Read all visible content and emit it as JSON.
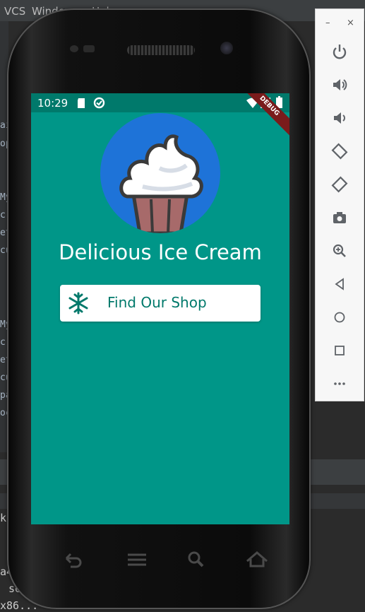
{
  "ide": {
    "menu": [
      "VCS",
      "Window",
      "Help"
    ],
    "code_lines": [
      "ai",
      "op",
      "My",
      "cr",
      "et",
      "cu",
      "My",
      "cr",
      "et",
      "cu",
      "pa",
      "oc"
    ],
    "terminal_lines": [
      "k",
      "s",
      "a42",
      "set",
      "x86..."
    ]
  },
  "app": {
    "status_time": "10:29",
    "debug_label": "DEBUG",
    "title": "Delicious Ice Cream",
    "button_label": "Find Our Shop",
    "colors": {
      "screen": "#009688",
      "status": "#00796b",
      "avatar": "#1e73d8",
      "button_text": "#00796b"
    }
  },
  "emulator": {
    "minimize": "–",
    "close": "×",
    "controls": [
      "power-icon",
      "volume-up-icon",
      "volume-down-icon",
      "rotate-left-icon",
      "rotate-right-icon",
      "camera-icon",
      "zoom-icon",
      "back-icon",
      "home-icon",
      "overview-icon",
      "more-icon"
    ]
  },
  "phone": {
    "softkeys": [
      "back-softkey-icon",
      "menu-softkey-icon",
      "search-softkey-icon",
      "home-softkey-icon"
    ]
  }
}
